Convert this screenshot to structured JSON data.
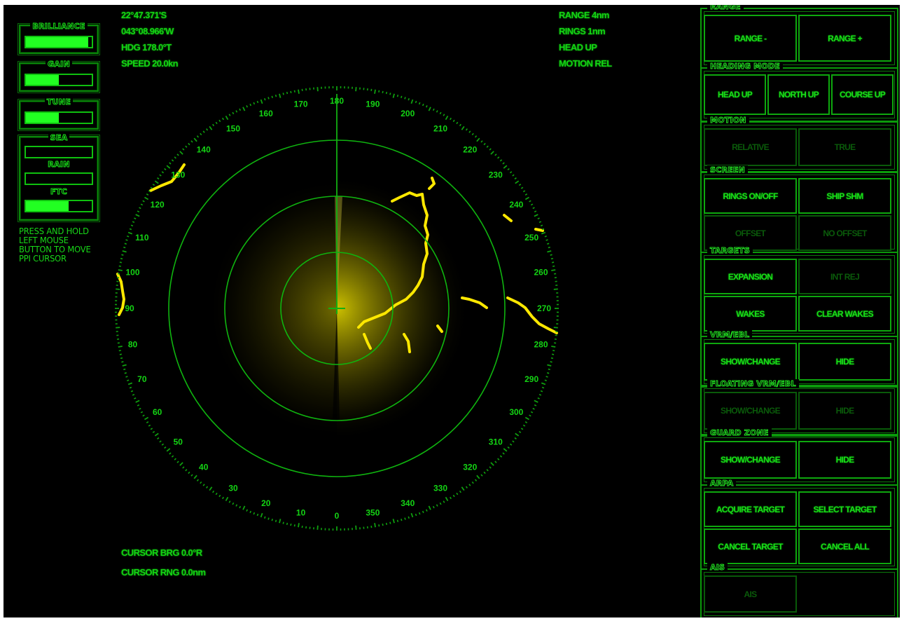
{
  "controls": [
    {
      "label": "BRILLIANCE",
      "value": 0.95
    },
    {
      "label": "GAIN",
      "value": 0.5
    },
    {
      "label": "TUNE",
      "value": 0.5
    },
    {
      "label": "SEA",
      "value": 0.0
    },
    {
      "label": "RAIN",
      "value": 0.0
    },
    {
      "label": "FTC",
      "value": 0.65
    }
  ],
  "help_text": [
    "PRESS AND HOLD",
    "LEFT MOUSE",
    "BUTTON TO MOVE",
    "PPI CURSOR"
  ],
  "nav_info": {
    "lat": "22°47.371'S",
    "lon": "043°08.966'W",
    "heading": "HDG 178.0°T",
    "speed": "SPEED 20.0kn"
  },
  "display_info": {
    "range": "RANGE 4nm",
    "rings": "RINGS 1nm",
    "orientation": "HEAD UP",
    "motion": "MOTION REL"
  },
  "cursor_info": {
    "bearing": "CURSOR BRG 0.0°R",
    "range": "CURSOR RNG 0.0nm"
  },
  "radar": {
    "range_nm": 4,
    "ring_spacing_nm": 1,
    "ring_count": 3,
    "heading_deg": 178,
    "top_bearing_label": 180,
    "bearing_labels": [
      0,
      10,
      20,
      30,
      40,
      50,
      60,
      70,
      80,
      90,
      100,
      110,
      120,
      130,
      140,
      150,
      160,
      170,
      180,
      190,
      200,
      210,
      220,
      230,
      240,
      250,
      260,
      270,
      280,
      290,
      300,
      310,
      320,
      330,
      340,
      350
    ],
    "colors": {
      "scale": "#14d414",
      "ring": "#0fb40f",
      "echo": "#ffe800",
      "heading_line": "#12b012"
    }
  },
  "panel": [
    {
      "title": "RANGE",
      "buttons": [
        {
          "label": "RANGE -",
          "enabled": true
        },
        {
          "label": "RANGE +",
          "enabled": true
        }
      ]
    },
    {
      "title": "HEADING MODE",
      "buttons": [
        {
          "label": "HEAD UP",
          "enabled": true
        },
        {
          "label": "NORTH UP",
          "enabled": true
        },
        {
          "label": "COURSE UP",
          "enabled": true
        }
      ]
    },
    {
      "title": "MOTION",
      "buttons": [
        {
          "label": "RELATIVE",
          "enabled": false
        },
        {
          "label": "TRUE",
          "enabled": false
        }
      ]
    },
    {
      "title": "SCREEN",
      "buttons": [
        {
          "label": "RINGS ON/OFF",
          "enabled": true
        },
        {
          "label": "SHIP SHM",
          "enabled": true
        },
        {
          "label": "OFFSET",
          "enabled": false
        },
        {
          "label": "NO OFFSET",
          "enabled": false
        }
      ]
    },
    {
      "title": "TARGETS",
      "buttons": [
        {
          "label": "EXPANSION",
          "enabled": true
        },
        {
          "label": "INT REJ",
          "enabled": false
        },
        {
          "label": "WAKES",
          "enabled": true
        },
        {
          "label": "CLEAR WAKES",
          "enabled": true
        }
      ]
    },
    {
      "title": "VRM/EBL",
      "buttons": [
        {
          "label": "SHOW/CHANGE",
          "enabled": true
        },
        {
          "label": "HIDE",
          "enabled": true
        }
      ]
    },
    {
      "title": "FLOATING VRM/EBL",
      "buttons": [
        {
          "label": "SHOW/CHANGE",
          "enabled": false
        },
        {
          "label": "HIDE",
          "enabled": false
        }
      ]
    },
    {
      "title": "GUARD ZONE",
      "buttons": [
        {
          "label": "SHOW/CHANGE",
          "enabled": true
        },
        {
          "label": "HIDE",
          "enabled": true
        }
      ]
    },
    {
      "title": "ARPA",
      "buttons": [
        {
          "label": "ACQUIRE TARGET",
          "enabled": true
        },
        {
          "label": "SELECT TARGET",
          "enabled": true
        },
        {
          "label": "CANCEL TARGET",
          "enabled": true
        },
        {
          "label": "CANCEL ALL",
          "enabled": true
        }
      ]
    },
    {
      "title": "AIS",
      "buttons": [
        {
          "label": "AIS",
          "enabled": false
        }
      ]
    }
  ]
}
